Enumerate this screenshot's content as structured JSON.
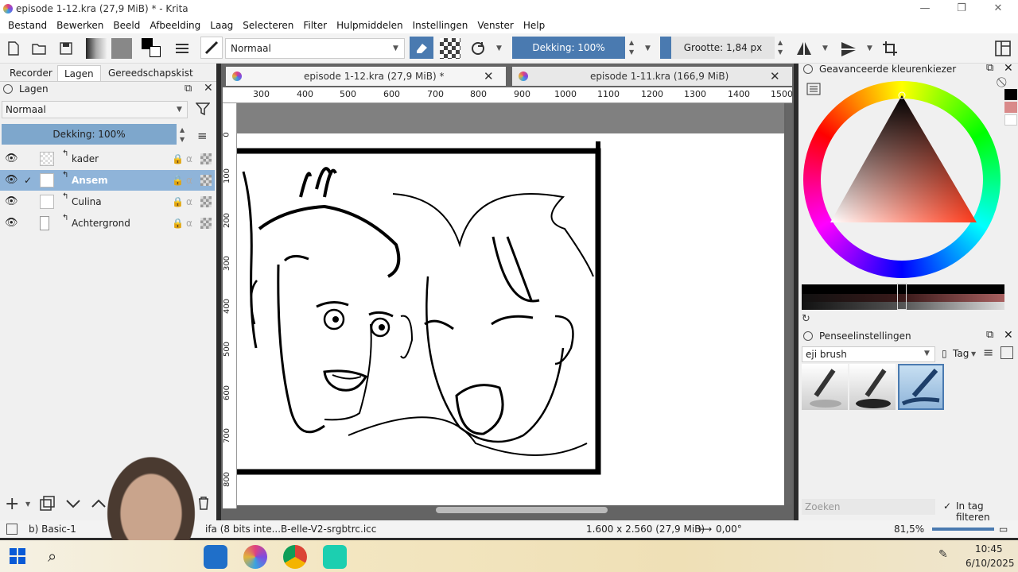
{
  "window": {
    "title": "episode 1-12.kra (27,9 MiB) * - Krita",
    "minimize": "—",
    "maximize": "❐",
    "close": "✕"
  },
  "menu": [
    "Bestand",
    "Bewerken",
    "Beeld",
    "Afbeelding",
    "Laag",
    "Selecteren",
    "Filter",
    "Hulpmiddelen",
    "Instellingen",
    "Venster",
    "Help"
  ],
  "toolbar": {
    "blend_mode": "Normaal",
    "opacity": "Dekking: 100%",
    "size": "Grootte: 1,84 px"
  },
  "left_tabs": [
    "Recorder",
    "Lagen",
    "Gereedschapskist"
  ],
  "layers_panel": {
    "title": "Lagen",
    "blend_mode": "Normaal",
    "opacity": "Dekking: 100%",
    "layers": [
      {
        "name": "kader",
        "check": ""
      },
      {
        "name": "Ansem",
        "check": "✓"
      },
      {
        "name": "Culina",
        "check": ""
      },
      {
        "name": "Achtergrond",
        "check": ""
      }
    ]
  },
  "doc_tabs": [
    {
      "label": "episode 1-12.kra (27,9 MiB) *"
    },
    {
      "label": "episode 1-11.kra (166,9 MiB)"
    }
  ],
  "ruler_h": [
    "300",
    "400",
    "500",
    "600",
    "700",
    "800",
    "900",
    "1000",
    "1100",
    "1200",
    "1300",
    "1400",
    "1500"
  ],
  "ruler_v": [
    "0",
    "100",
    "200",
    "300",
    "400",
    "500",
    "600",
    "700",
    "800"
  ],
  "color_panel": {
    "title": "Geavanceerde kleurenkiezer"
  },
  "brush_panel": {
    "title": "Penseelinstellingen",
    "preset": "eji brush",
    "tag": "Tag",
    "search_placeholder": "Zoeken",
    "filter_label": "In tag filteren"
  },
  "status": {
    "brush": "b) Basic-1",
    "colorspace": "ifa (8 bits inte...B-elle-V2-srgbtrc.icc",
    "dimensions": "1.600 x 2.560 (27,9 MiB)",
    "rotation": "0,00°",
    "zoom": "81,5%"
  },
  "taskbar": {
    "time": "10:45",
    "date": "6/10/2025"
  }
}
